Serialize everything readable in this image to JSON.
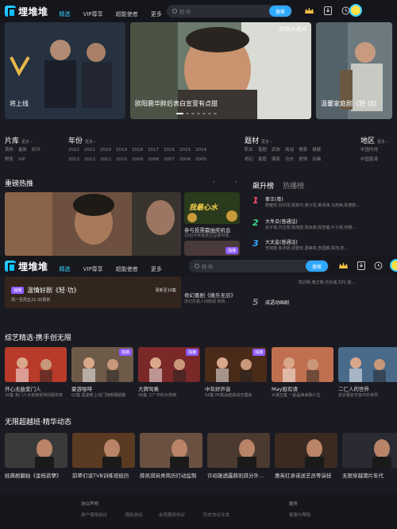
{
  "app": {
    "logo": "埋堆堆"
  },
  "nav": {
    "items": [
      "精选",
      "VIP尊享",
      "超能使者",
      "更多"
    ]
  },
  "search": {
    "placeholder": "轻·功",
    "button": "搜索"
  },
  "hero": {
    "slides": [
      "将上线",
      "欧阳震华醉后表白宣萱有点甜",
      "温馨家庭剧《轻·功》"
    ],
    "badge": "终极大奇兵"
  },
  "categories": [
    {
      "title": "片库",
      "more": "更多 ›",
      "tags": [
        "首热",
        "最新",
        "好评",
        "限免",
        "VIP"
      ]
    },
    {
      "title": "年份",
      "more": "更多 ›",
      "tags": [
        "2022",
        "2021",
        "2020",
        "2019",
        "2018",
        "2017",
        "2016",
        "2015",
        "2014",
        "2013",
        "2012",
        "2011",
        "2010",
        "2009",
        "2008",
        "2007",
        "2006",
        "2005"
      ]
    },
    {
      "title": "题材",
      "more": "更多 ›",
      "tags": [
        "职业",
        "喜剧",
        "武侠",
        "商战",
        "情景",
        "悬疑",
        "奇幻",
        "家庭",
        "爆笑",
        "功夫",
        "爱情",
        "动画"
      ]
    },
    {
      "title": "地区",
      "more": "更多 ›",
      "tags": [
        "中国内地",
        "中国香港"
      ]
    }
  ],
  "featured": {
    "title": "重磅热推",
    "card_title": "温情好剧《轻·功》",
    "card_sub": "周一至周五21:30更新",
    "card_update": "更新至10集",
    "side_cards": [
      {
        "title": "参与投票赢抽奖机会",
        "sub": "10位中奖嘉宾豆豆即可收..."
      },
      {
        "title": "奇幻喜剧《换乐无穷》",
        "sub": "亦幻亦真人间热闹 欢快..."
      }
    ],
    "side_poster": "我最心水",
    "side_badge": "独播"
  },
  "ranking": {
    "tabs": [
      "飙升榜",
      "热播榜"
    ],
    "items": [
      {
        "n": "1",
        "title": "拳王(粤)",
        "sub": "黎耀祥,刘印泽,陈奕巧,黄子恒,黄泽锋,马苑荣,陈德彬..."
      },
      {
        "n": "2",
        "title": "大冬瓜(普通话)",
        "sub": "余子锦,刘玉翠,陈丽雯,陈启泰,陈智健,叶子辉,林德..."
      },
      {
        "n": "3",
        "title": "大太监(普通话)",
        "sub": "李锦隆,陈沛妍,郭晋安,邵美琪,李国麟,陈炜,李..."
      },
      {
        "n": "4",
        "title": "",
        "sub": "张兆辉,黄正楠,洪永城,刘丹,施..."
      },
      {
        "n": "5",
        "title": "成语动画剧",
        "sub": ""
      }
    ]
  },
  "overlay_bar": {
    "badge_text": "独播",
    "more_text": "陈兆辉,黄正楠,洪永城,刘丹,施..."
  },
  "variety": {
    "title": "综艺精选·携手创无限",
    "items": [
      {
        "t": "开心无敌爱门人",
        "s": "20集 和门人大家接受特别服务表",
        "b": ""
      },
      {
        "t": "豪游咖啡",
        "s": "02集 医康新上线门随眼细腻棚",
        "b": "独播"
      },
      {
        "t": "大牌驾乘",
        "s": "06集 工厂中的大排档",
        "b": "独播"
      },
      {
        "t": "中年好声音",
        "s": "04集 PK挑战者挑战无理由",
        "b": "独播"
      },
      {
        "t": "May姐有请",
        "s": "大哉五集 一起晶美食聊人生",
        "b": ""
      },
      {
        "t": "二仁人的世界",
        "s": "走近著名宇宙中的世界",
        "b": ""
      }
    ]
  },
  "vshort": {
    "title": "无限超越班·精华动态",
    "items": [
      {
        "t": "经典剧翻拍《金枝欲孽》"
      },
      {
        "t": "前辈们谈TVB训练班经历"
      },
      {
        "t": "薛凯琪另类简历打动监制"
      },
      {
        "t": "许绍雄透露薛凯琪分外..."
      },
      {
        "t": "惠英红承诺送艺员等演技"
      },
      {
        "t": "无限穿越港片年代"
      }
    ]
  },
  "footer": {
    "col1": [
      "协议声明",
      "用户使用协议",
      "隐私协议",
      "会员服务协议",
      "历史协议文本"
    ],
    "col2": [
      "服务",
      "客服与帮助"
    ]
  },
  "colors": {
    "accent": "#36d1ff",
    "badge": "#8e5bff",
    "bg": "#1a1a22"
  }
}
